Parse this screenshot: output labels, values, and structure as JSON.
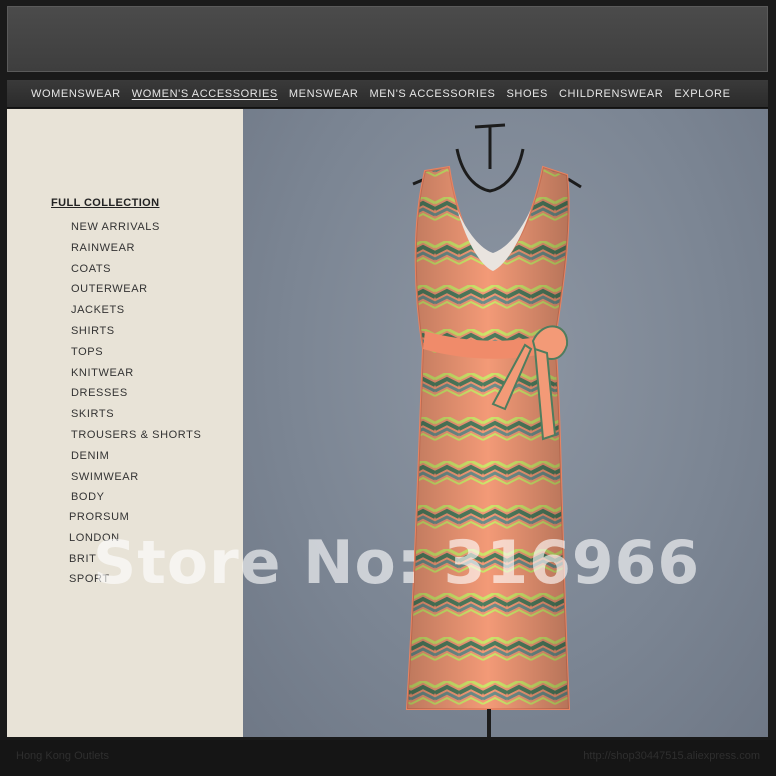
{
  "nav": {
    "items": [
      "WOMENSWEAR",
      "WOMEN'S ACCESSORIES",
      "MENSWEAR",
      "MEN'S ACCESSORIES",
      "SHOES",
      "CHILDRENSWEAR",
      "EXPLORE"
    ],
    "active_index": 1
  },
  "sidebar": {
    "heading": "FULL COLLECTION",
    "items": [
      "NEW ARRIVALS",
      "RAINWEAR",
      "COATS",
      "OUTERWEAR",
      "JACKETS",
      "SHIRTS",
      "TOPS",
      "KNITWEAR",
      "DRESSES",
      "SKIRTS",
      "TROUSERS & SHORTS",
      "DENIM",
      "SWIMWEAR",
      "BODY"
    ],
    "labels": [
      "PRORSUM",
      "LONDON",
      "BRIT",
      "SPORT"
    ]
  },
  "watermark": "Store No: 316966",
  "footer": {
    "left": "Hong Kong Outlets",
    "right": "http://shop30447515.aliexpress.com"
  },
  "colors": {
    "photo_bg": "#7b8593",
    "sidebar_bg": "#e8e3d7",
    "nav_bg": "#2f2f2f",
    "dress_peach": "#f39a77",
    "dress_green": "#4f7d5e",
    "dress_lime": "#cde56a"
  }
}
